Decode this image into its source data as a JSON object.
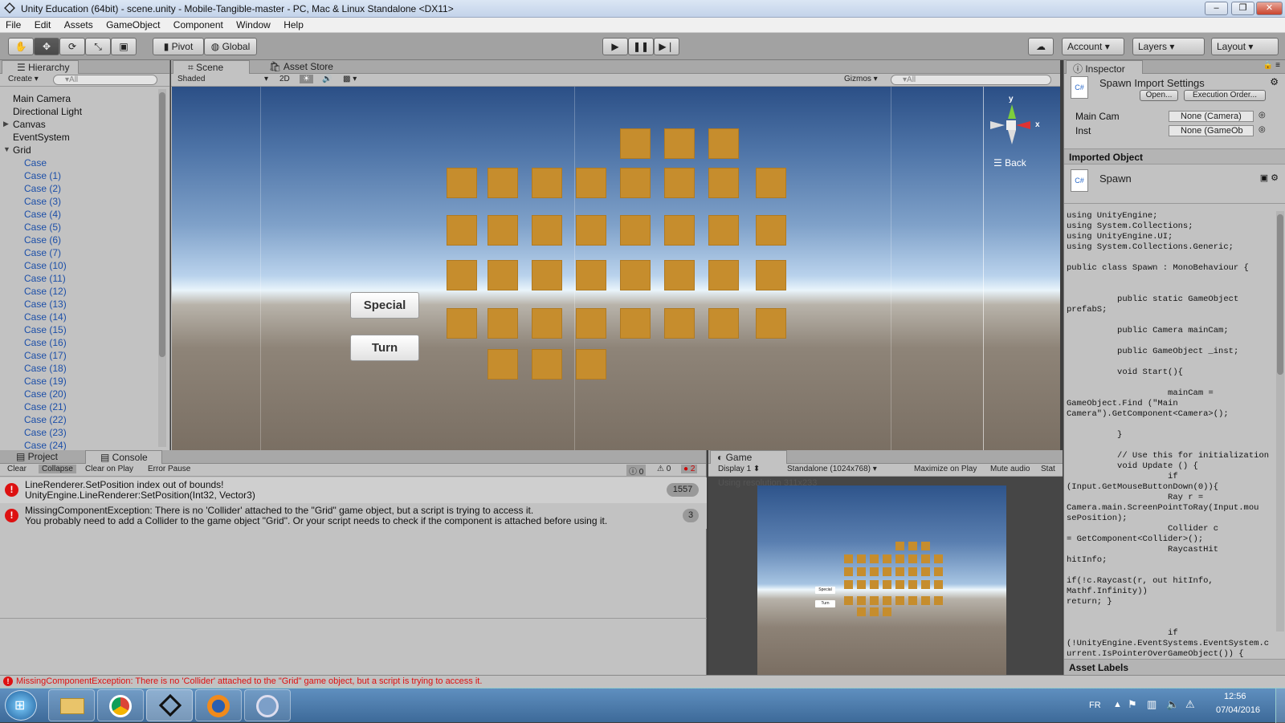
{
  "window": {
    "title": "Unity Education (64bit) - scene.unity - Mobile-Tangible-master - PC, Mac & Linux Standalone <DX11>"
  },
  "menu": [
    "File",
    "Edit",
    "Assets",
    "GameObject",
    "Component",
    "Window",
    "Help"
  ],
  "toolbar": {
    "pivot": "Pivot",
    "global": "Global",
    "account": "Account",
    "layers": "Layers",
    "layout": "Layout"
  },
  "hierarchy": {
    "tab": "Hierarchy",
    "create": "Create",
    "search_placeholder": "▾All",
    "roots": [
      "Main Camera",
      "Directional Light",
      "Canvas",
      "EventSystem",
      "Grid"
    ],
    "children": [
      "Case",
      "Case (1)",
      "Case (2)",
      "Case (3)",
      "Case (4)",
      "Case (5)",
      "Case (6)",
      "Case (7)",
      "Case (10)",
      "Case (11)",
      "Case (12)",
      "Case (13)",
      "Case (14)",
      "Case (15)",
      "Case (16)",
      "Case (17)",
      "Case (18)",
      "Case (19)",
      "Case (20)",
      "Case (21)",
      "Case (22)",
      "Case (23)",
      "Case (24)"
    ]
  },
  "scene": {
    "tab_scene": "Scene",
    "tab_store": "Asset Store",
    "shading": "Shaded",
    "mode2d": "2D",
    "gizmos": "Gizmos",
    "search_placeholder": "▾All",
    "gizmo_y": "y",
    "gizmo_x": "x",
    "back": "Back",
    "buttons": {
      "special": "Special",
      "turn": "Turn"
    },
    "tile_rows": [
      3,
      8,
      8,
      8,
      8,
      3
    ]
  },
  "inspector": {
    "tab": "Inspector",
    "title": "Spawn Import Settings",
    "open": "Open...",
    "exec": "Execution Order...",
    "fields": [
      {
        "label": "Main Cam",
        "value": "None (Camera)"
      },
      {
        "label": "Inst",
        "value": "None (GameOb"
      }
    ],
    "imported": "Imported Object",
    "script_name": "Spawn",
    "code": "using UnityEngine;\nusing System.Collections;\nusing UnityEngine.UI;\nusing System.Collections.Generic;\n\npublic class Spawn : MonoBehaviour {\n\n\n          public static GameObject\nprefabS;\n\n          public Camera mainCam;\n\n          public GameObject _inst;\n\n          void Start(){\n\n                    mainCam =\nGameObject.Find (\"Main\nCamera\").GetComponent<Camera>();\n\n          }\n\n          // Use this for initialization\n          void Update () {\n                    if\n(Input.GetMouseButtonDown(0)){\n                    Ray r =\nCamera.main.ScreenPointToRay(Input.mou\nsePosition);\n                    Collider c\n= GetComponent<Collider>();\n                    RaycastHit\nhitInfo;\n\nif(!c.Raycast(r, out hitInfo, Mathf.Infinity))\nreturn; }\n\n\n                    if\n(!UnityEngine.EventSystems.EventSystem.c\nurrent.IsPointerOverGameObject()) {",
    "asset_labels": "Asset Labels"
  },
  "console": {
    "tab_project": "Project",
    "tab_console": "Console",
    "buttons": [
      "Clear",
      "Collapse",
      "Clear on Play",
      "Error Pause"
    ],
    "counts": {
      "info": "0",
      "warn": "0",
      "error": "2"
    },
    "entries": [
      {
        "line1": "LineRenderer.SetPosition index out of bounds!",
        "line2": "UnityEngine.LineRenderer:SetPosition(Int32, Vector3)",
        "count": "1557"
      },
      {
        "line1": "MissingComponentException: There is no 'Collider' attached to the \"Grid\" game object, but a script is trying to access it.",
        "line2": "You probably need to add a Collider to the game object \"Grid\". Or your script needs to check if the component is attached before using it.",
        "count": "3"
      }
    ]
  },
  "game": {
    "tab": "Game",
    "display": "Display 1",
    "resolution": "Standalone (1024x768)",
    "maximize": "Maximize on Play",
    "mute": "Mute audio",
    "stats": "Stat",
    "using": "Using resolution 311x233",
    "special": "Special",
    "turn": "Turn"
  },
  "status": "MissingComponentException: There is no 'Collider' attached to the \"Grid\" game object, but a script is trying to access it.",
  "taskbar": {
    "lang": "FR",
    "time": "12:56",
    "date": "07/04/2016"
  }
}
